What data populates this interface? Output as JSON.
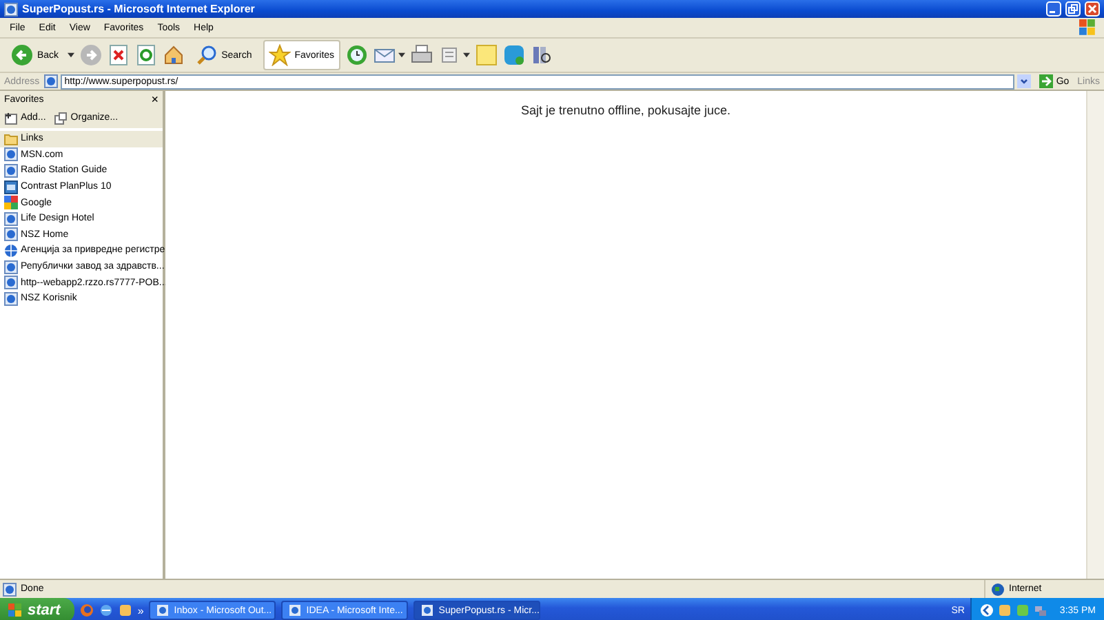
{
  "window": {
    "title": "SuperPopust.rs - Microsoft Internet Explorer"
  },
  "menu": [
    "File",
    "Edit",
    "View",
    "Favorites",
    "Tools",
    "Help"
  ],
  "toolbar": {
    "back": "Back",
    "search": "Search",
    "favorites": "Favorites"
  },
  "address": {
    "label": "Address",
    "value": "http://www.superpopust.rs/",
    "go": "Go",
    "links": "Links"
  },
  "favorites_pane": {
    "title": "Favorites",
    "close": "×",
    "add": "Add...",
    "organize": "Organize...",
    "items": [
      {
        "label": "Links",
        "kind": "folder",
        "selected": true
      },
      {
        "label": "MSN.com",
        "kind": "page",
        "selected": false
      },
      {
        "label": "Radio Station Guide",
        "kind": "page",
        "selected": false
      },
      {
        "label": "Contrast PlanPlus 10",
        "kind": "app",
        "selected": false
      },
      {
        "label": "Google",
        "kind": "google",
        "selected": false
      },
      {
        "label": "Life Design Hotel",
        "kind": "page",
        "selected": false
      },
      {
        "label": "NSZ  Home",
        "kind": "page",
        "selected": false
      },
      {
        "label": "Агенција за привредне регистре",
        "kind": "globe",
        "selected": false
      },
      {
        "label": "Републички завод за здравств...",
        "kind": "page",
        "selected": false
      },
      {
        "label": "http--webapp2.rzzo.rs7777-POB...",
        "kind": "page",
        "selected": false
      },
      {
        "label": "NSZ  Korisnik",
        "kind": "page",
        "selected": false
      }
    ]
  },
  "content": {
    "message": "Sajt je trenutno offline, pokusajte juce."
  },
  "status_bar": {
    "text": "Done",
    "zone": "Internet"
  },
  "taskbar": {
    "start": "start",
    "more": "»",
    "windows": [
      {
        "label": "Inbox - Microsoft Out...",
        "selected": false
      },
      {
        "label": "IDEA - Microsoft Inte...",
        "selected": false
      },
      {
        "label": "SuperPopust.rs - Micr...",
        "selected": true
      }
    ],
    "language": "SR",
    "clock": "3:35 PM"
  }
}
